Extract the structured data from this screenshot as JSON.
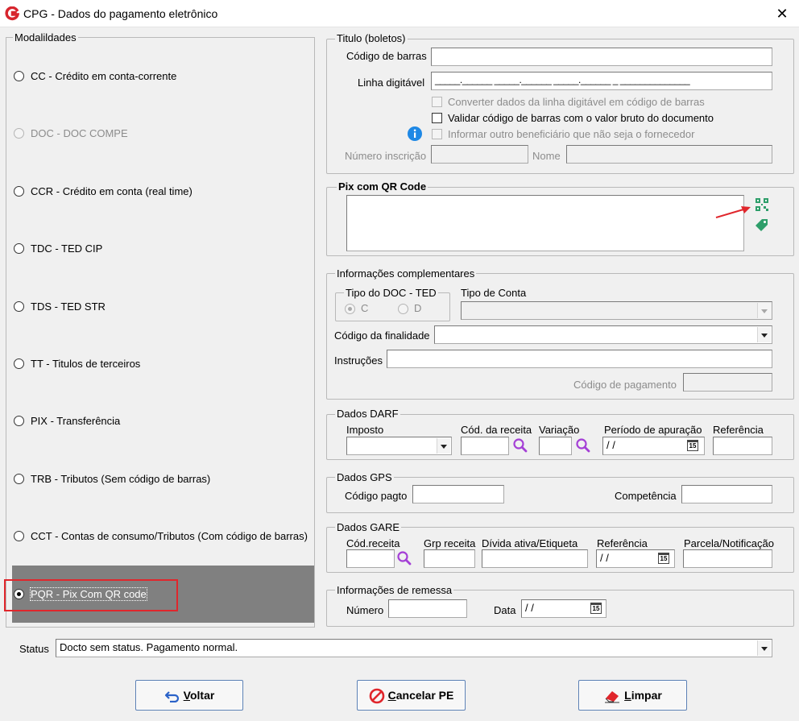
{
  "window": {
    "title": "CPG - Dados do pagamento eletrônico",
    "close": "✕"
  },
  "modalidades": {
    "legend": "Modalildades",
    "items": [
      {
        "label": "CC  - Crédito em conta-corrente",
        "enabled": true,
        "selected": false
      },
      {
        "label": "DOC - DOC COMPE",
        "enabled": false,
        "selected": false
      },
      {
        "label": "CCR - Crédito em conta (real time)",
        "enabled": true,
        "selected": false
      },
      {
        "label": "TDC - TED CIP",
        "enabled": true,
        "selected": false
      },
      {
        "label": "TDS - TED STR",
        "enabled": true,
        "selected": false
      },
      {
        "label": "TT  - Titulos de terceiros",
        "enabled": true,
        "selected": false
      },
      {
        "label": "PIX - Transferência",
        "enabled": true,
        "selected": false
      },
      {
        "label": "TRB - Tributos (Sem código de barras)",
        "enabled": true,
        "selected": false
      },
      {
        "label": "CCT - Contas de consumo/Tributos (Com código de barras)",
        "enabled": true,
        "selected": false
      },
      {
        "label": "PQR - Pix Com QR code",
        "enabled": true,
        "selected": true
      }
    ]
  },
  "titulo": {
    "legend": "Titulo (boletos)",
    "codigo_barras_label": "Código de barras",
    "codigo_barras_value": "",
    "linha_digitavel_label": "Linha digitável",
    "linha_digitavel_value": "_____.______ _____.______ _____.______ _ ______________",
    "chk_converter": "Converter dados da linha digitável em código de barras",
    "chk_validar": "Validar código de barras com o valor bruto do documento",
    "chk_informar": "Informar outro beneficiário que não seja o fornecedor",
    "numero_inscricao_label": "Número inscrição",
    "numero_inscricao_value": "",
    "nome_label": "Nome",
    "nome_value": ""
  },
  "pix_qr": {
    "legend": "Pix com QR Code",
    "value": ""
  },
  "info_compl": {
    "legend": "Informações complementares",
    "tipo_doc_legend": "Tipo do DOC - TED",
    "radio_c": "C",
    "radio_d": "D",
    "tipo_conta_label": "Tipo de Conta",
    "tipo_conta_value": "",
    "codigo_finalidade_label": "Código da finalidade",
    "codigo_finalidade_value": "",
    "instrucoes_label": "Instruções",
    "instrucoes_value": "",
    "codigo_pagamento_label": "Código de pagamento",
    "codigo_pagamento_value": ""
  },
  "darf": {
    "legend": "Dados DARF",
    "imposto_label": "Imposto",
    "cod_receita_label": "Cód. da receita",
    "variacao_label": "Variação",
    "periodo_label": "Período de apuração",
    "periodo_value": " / /",
    "referencia_label": "Referência"
  },
  "gps": {
    "legend": "Dados GPS",
    "codigo_pagto_label": "Código pagto",
    "competencia_label": "Competência"
  },
  "gare": {
    "legend": "Dados GARE",
    "cod_receita_label": "Cód.receita",
    "grp_receita_label": "Grp receita",
    "divida_label": "Dívida ativa/Etiqueta",
    "referencia_label": "Referência",
    "referencia_value": " / /",
    "parcela_label": "Parcela/Notificação"
  },
  "remessa": {
    "legend": "Informações de remessa",
    "numero_label": "Número",
    "data_label": "Data",
    "data_value": " / /"
  },
  "status": {
    "label": "Status",
    "value": "Docto sem status. Pagamento normal."
  },
  "calendar_glyph": "15",
  "buttons": {
    "voltar": {
      "accel": "V",
      "rest": "oltar"
    },
    "cancelar": {
      "accel": "C",
      "rest": "ancelar PE"
    },
    "limpar": {
      "accel": "L",
      "rest": "impar"
    }
  },
  "colors": {
    "selection": "#808080",
    "highlight_box": "#e0262c",
    "button_border": "#5a7fb4",
    "app_logo": "#d7262e"
  }
}
